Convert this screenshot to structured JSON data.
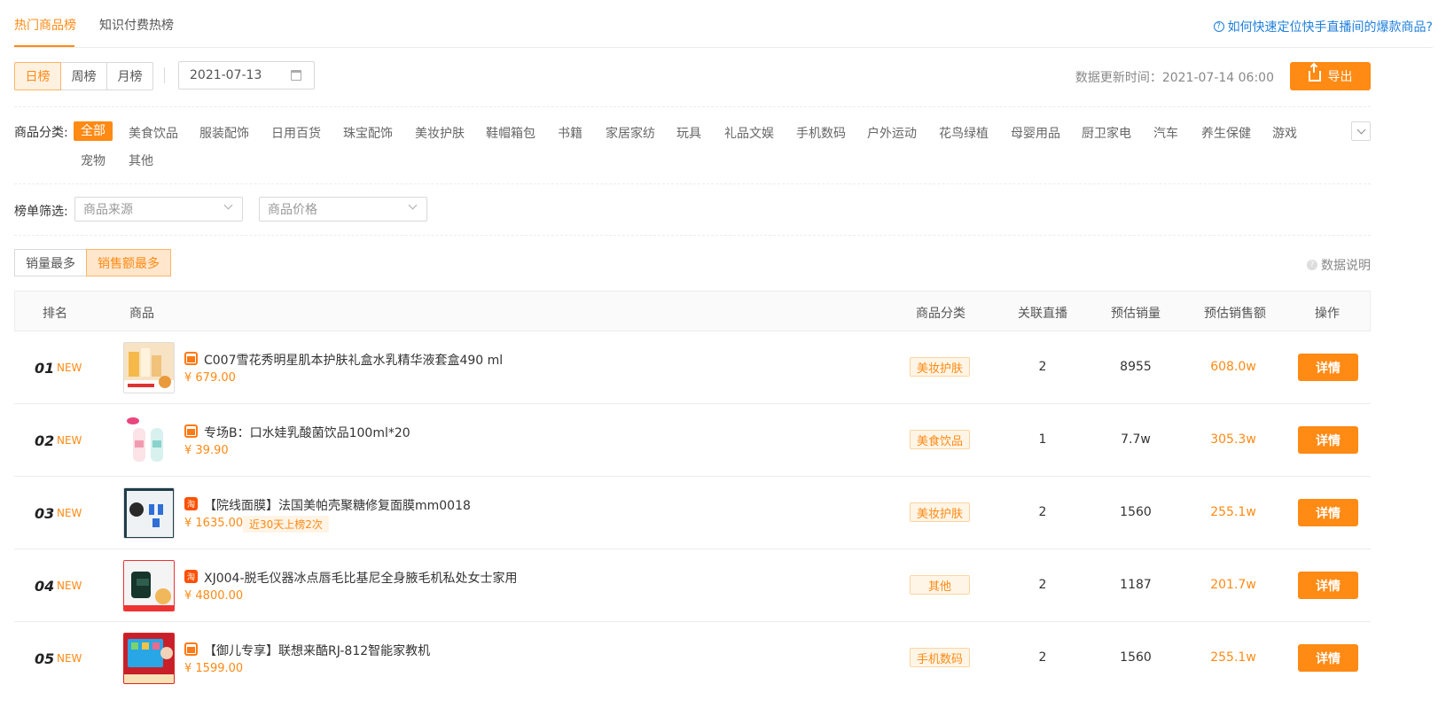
{
  "tabs": [
    {
      "label": "热门商品榜",
      "active": true
    },
    {
      "label": "知识付费热榜",
      "active": false
    }
  ],
  "help_link": "如何快速定位快手直播间的爆款商品?",
  "period_buttons": [
    {
      "label": "日榜",
      "active": true
    },
    {
      "label": "周榜",
      "active": false
    },
    {
      "label": "月榜",
      "active": false
    }
  ],
  "date_value": "2021-07-13",
  "update_time": "数据更新时间：2021-07-14 06:00",
  "export_label": "导出",
  "category": {
    "label": "商品分类:",
    "items": [
      "全部",
      "美食饮品",
      "服装配饰",
      "日用百货",
      "珠宝配饰",
      "美妆护肤",
      "鞋帽箱包",
      "书籍",
      "家居家纺",
      "玩具",
      "礼品文娱",
      "手机数码",
      "户外运动",
      "花鸟绿植",
      "母婴用品",
      "厨卫家电",
      "汽车",
      "养生保健",
      "游戏",
      "宠物",
      "其他"
    ],
    "active": "全部"
  },
  "filter": {
    "label": "榜单筛选:",
    "source_placeholder": "商品来源",
    "price_placeholder": "商品价格"
  },
  "sort_buttons": [
    {
      "label": "销量最多",
      "active": false
    },
    {
      "label": "销售额最多",
      "active": true
    }
  ],
  "data_note": "数据说明",
  "table": {
    "headers": [
      "排名",
      "商品",
      "商品分类",
      "关联直播",
      "预估销量",
      "预估销售额",
      "操作"
    ],
    "rows": [
      {
        "rank": "01",
        "badge": "NEW",
        "platform": "kuaishou",
        "name": "C007雪花秀明星肌本护肤礼盒水乳精华液套盒490 ml",
        "price": "¥ 679.00",
        "tag": "",
        "category": "美妆护肤",
        "live": "2",
        "sales": "8955",
        "amount": "608.0w",
        "action": "详情"
      },
      {
        "rank": "02",
        "badge": "NEW",
        "platform": "kuaishou",
        "name": "专场B：口水娃乳酸菌饮品100ml*20",
        "price": "¥ 39.90",
        "tag": "",
        "category": "美食饮品",
        "live": "1",
        "sales": "7.7w",
        "amount": "305.3w",
        "action": "详情"
      },
      {
        "rank": "03",
        "badge": "NEW",
        "platform": "taobao",
        "name": "【院线面膜】法国美帕壳聚糖修复面膜mm0018",
        "price": "¥ 1635.00",
        "tag": "近30天上榜2次",
        "category": "美妆护肤",
        "live": "2",
        "sales": "1560",
        "amount": "255.1w",
        "action": "详情"
      },
      {
        "rank": "04",
        "badge": "NEW",
        "platform": "taobao",
        "name": "XJ004-脱毛仪器冰点唇毛比基尼全身腋毛机私处女士家用",
        "price": "¥ 4800.00",
        "tag": "",
        "category": "其他",
        "live": "2",
        "sales": "1187",
        "amount": "201.7w",
        "action": "详情"
      },
      {
        "rank": "05",
        "badge": "NEW",
        "platform": "kuaishou",
        "name": "【御儿专享】联想来酷RJ-812智能家教机",
        "price": "¥ 1599.00",
        "tag": "",
        "category": "手机数码",
        "live": "2",
        "sales": "1560",
        "amount": "255.1w",
        "action": "详情"
      }
    ]
  },
  "colors": {
    "accent": "#ff8a14",
    "link": "#1f7fdc"
  }
}
